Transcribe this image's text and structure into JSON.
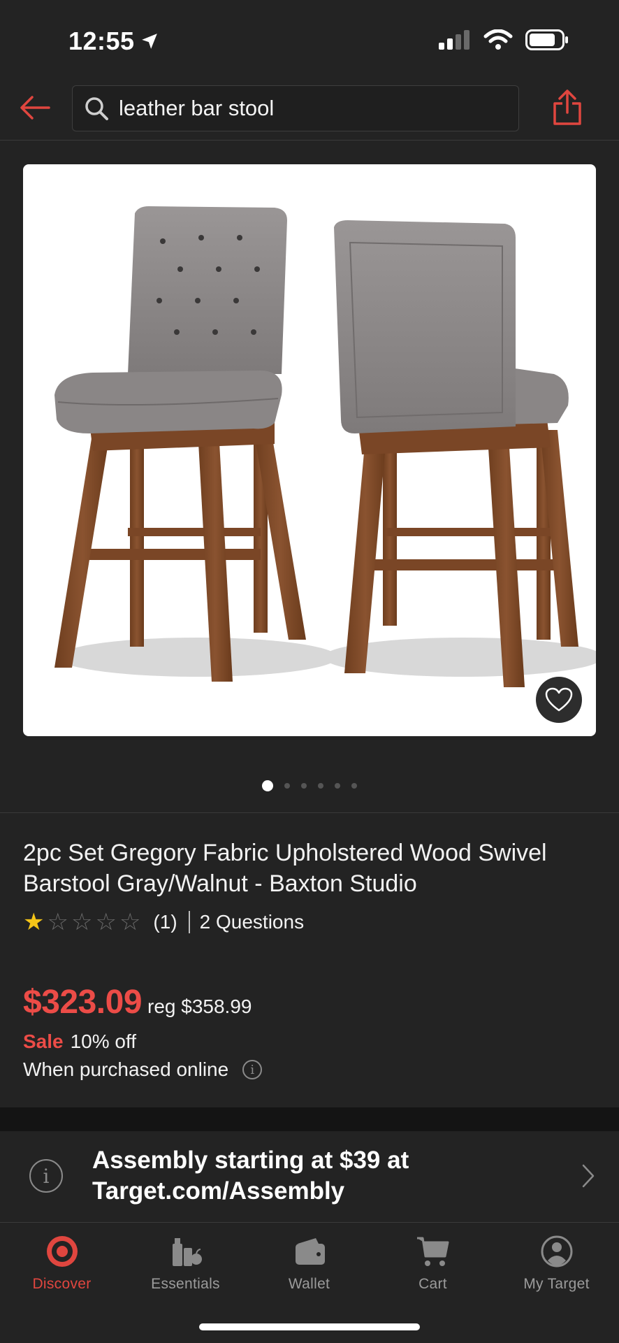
{
  "status_bar": {
    "time": "12:55"
  },
  "header": {
    "search_value": "leather bar stool"
  },
  "gallery": {
    "image_count": 6,
    "active_index": 0
  },
  "product": {
    "title": "2pc Set Gregory Fabric Upholstered Wood Swivel Barstool Gray/Walnut - Baxton Studio",
    "rating": 1,
    "rating_max": 5,
    "review_count": "(1)",
    "questions": "2 Questions",
    "price": "$323.09",
    "reg_price": "reg $358.99",
    "sale_label": "Sale",
    "discount": "10% off",
    "purchase_note": "When purchased online"
  },
  "assembly": {
    "text": "Assembly starting at $39 at Target.com/Assembly"
  },
  "tabbar": {
    "items": [
      {
        "label": "Discover",
        "icon": "target-logo-icon",
        "active": true
      },
      {
        "label": "Essentials",
        "icon": "essentials-icon",
        "active": false
      },
      {
        "label": "Wallet",
        "icon": "wallet-icon",
        "active": false
      },
      {
        "label": "Cart",
        "icon": "cart-icon",
        "active": false
      },
      {
        "label": "My Target",
        "icon": "profile-icon",
        "active": false
      }
    ]
  },
  "colors": {
    "accent": "#e0463f",
    "price": "#ec4c47",
    "background": "#232323",
    "star_filled": "#f5c518"
  }
}
